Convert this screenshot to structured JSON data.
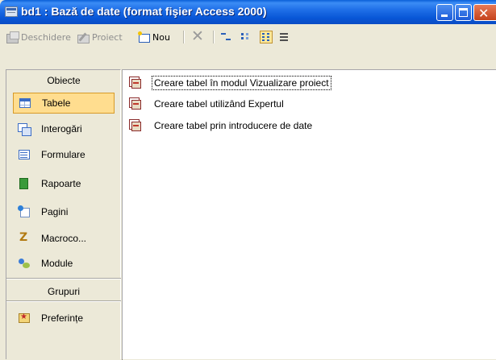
{
  "window": {
    "title": "bd1 : Bază de date (format fişier Access 2000)"
  },
  "toolbar": {
    "open_label": "Deschidere",
    "design_label": "Proiect",
    "new_label": "Nou",
    "delete_icon": "delete-x-icon",
    "view_icons": [
      "large-icons-view",
      "small-icons-view",
      "list-view",
      "details-view"
    ],
    "active_view": "list-view"
  },
  "objects_panel": {
    "header": "Obiecte",
    "items": [
      {
        "label": "Tabele",
        "icon": "table-icon",
        "selected": true
      },
      {
        "label": "Interogări",
        "icon": "query-icon"
      },
      {
        "label": "Formulare",
        "icon": "form-icon"
      },
      {
        "label": "Rapoarte",
        "icon": "report-icon"
      },
      {
        "label": "Pagini",
        "icon": "page-icon"
      },
      {
        "label": "Macroco...",
        "icon": "macro-icon"
      },
      {
        "label": "Module",
        "icon": "module-icon"
      }
    ],
    "groups_header": "Grupuri",
    "groups": [
      {
        "label": "Preferințe",
        "icon": "favorites-folder-icon"
      }
    ]
  },
  "content_list": {
    "items": [
      {
        "label": "Creare tabel în modul Vizualizare proiect",
        "focused": true
      },
      {
        "label": "Creare tabel utilizând Expertul"
      },
      {
        "label": "Creare tabel prin introducere de date"
      }
    ]
  },
  "colors": {
    "titlebar": "#0a5fd8",
    "selection": "#ffdd8f",
    "selection_border": "#d79a28",
    "window_bg": "#ece9d8"
  }
}
